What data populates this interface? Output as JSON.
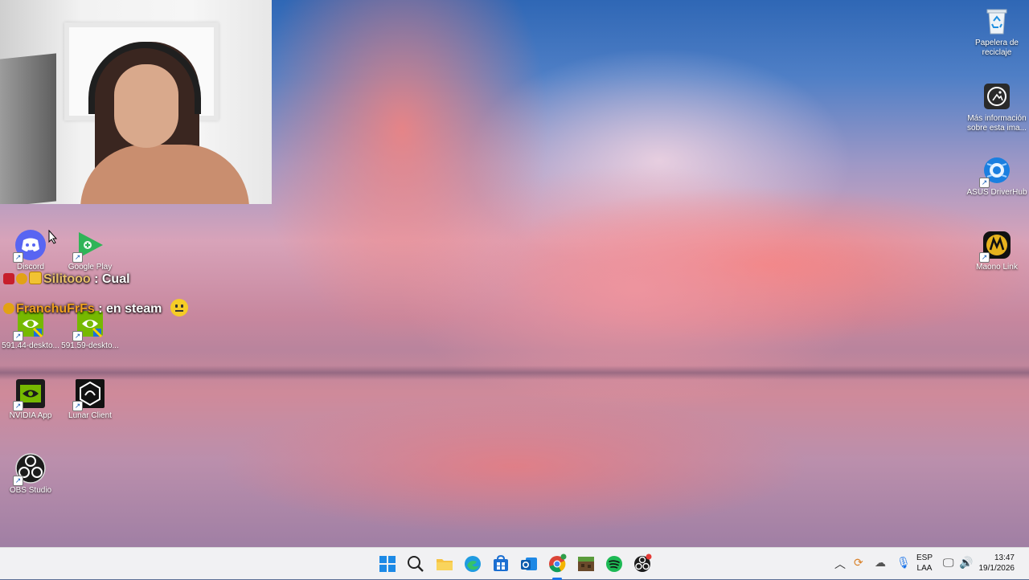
{
  "desktop": {
    "icons_left": [
      {
        "label": "Discord",
        "icon": "discord-icon"
      },
      {
        "label": "Google Play",
        "icon": "google-play-icon"
      },
      {
        "label": "591.44-deskto...",
        "icon": "nvidia-installer-icon"
      },
      {
        "label": "591.59-deskto...",
        "icon": "nvidia-installer-icon"
      },
      {
        "label": "NVIDIA App",
        "icon": "nvidia-app-icon"
      },
      {
        "label": "Lunar Client",
        "icon": "lunar-client-icon"
      },
      {
        "label": "OBS Studio",
        "icon": "obs-studio-icon"
      }
    ],
    "icons_right": [
      {
        "label": "Papelera de reciclaje",
        "icon": "recycle-bin-icon"
      },
      {
        "label": "Más información sobre esta ima...",
        "icon": "spotlight-info-icon"
      },
      {
        "label": "ASUS DriverHub",
        "icon": "asus-driverhub-icon"
      },
      {
        "label": "Maono Link",
        "icon": "maono-link-icon"
      }
    ]
  },
  "chat_overlay": [
    {
      "user": "Silitooo",
      "separator": " : ",
      "message": "Cual"
    },
    {
      "user": "FranchuFrFs",
      "separator": " : ",
      "message": "en steam"
    }
  ],
  "taskbar": {
    "apps": [
      "start-icon",
      "search-icon",
      "file-explorer-icon",
      "edge-icon",
      "store-icon",
      "outlook-icon",
      "chrome-icon",
      "minecraft-icon",
      "spotify-icon",
      "obs-icon"
    ],
    "language_top": "ESP",
    "language_bottom": "LAA",
    "time": "13:47",
    "date": "19/1/2026"
  },
  "colors": {
    "chat_user_1": "#e8c06a",
    "chat_user_2": "#f0a020",
    "taskbar_bg": "#f1f1f3",
    "accent": "#1a73e8"
  }
}
